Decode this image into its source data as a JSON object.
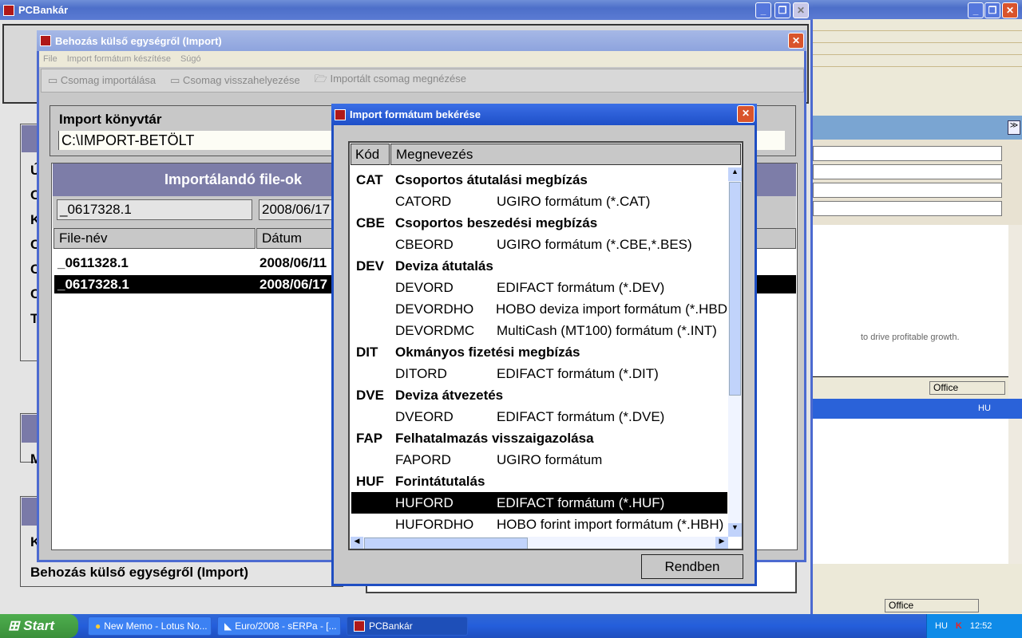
{
  "main_window": {
    "title": "PCBankár"
  },
  "background_panels": {
    "letters": [
      "Ú",
      "C",
      "K",
      "C",
      "C",
      "C",
      "T"
    ],
    "mid_letter": "M",
    "bottom_letter": "K",
    "bottom_label": "Behozás külső egységről (Import)"
  },
  "right_window": {
    "snippet": "to drive profitable growth.",
    "status_office": "Office",
    "lang": "HU",
    "status_office2": "Office"
  },
  "import_window": {
    "title": "Behozás külső egységről (Import)",
    "menu": [
      "File",
      "Import formátum készítése",
      "Súgó"
    ],
    "toolbar": [
      "Csomag importálása",
      "Csomag visszahelyezése",
      "Importált csomag megnézése"
    ],
    "dir_label": "Import könyvtár",
    "dir_value": "C:\\IMPORT-BETÖLT",
    "files_header": "Importálandó file-ok",
    "filter_name": "_0617328.1",
    "filter_date": "2008/06/17 1",
    "columns": [
      "File-név",
      "Dátum"
    ],
    "files": [
      {
        "name": "_0611328.1",
        "date": "2008/06/11"
      },
      {
        "name": "_0617328.1",
        "date": "2008/06/17"
      }
    ]
  },
  "dialog": {
    "title": "Import formátum bekérése",
    "columns": [
      "Kód",
      "Megnevezés"
    ],
    "groups": [
      {
        "code": "CAT",
        "name": "Csoportos átutalási megbízás",
        "items": [
          [
            "CATORD",
            "UGIRO formátum  (*.CAT)"
          ]
        ]
      },
      {
        "code": "CBE",
        "name": "Csoportos beszedési megbízás",
        "items": [
          [
            "CBEORD",
            "UGIRO formátum  (*.CBE,*.BES)"
          ]
        ]
      },
      {
        "code": "DEV",
        "name": "Deviza átutalás",
        "items": [
          [
            "DEVORD",
            "EDIFACT formátum  (*.DEV)"
          ],
          [
            "DEVORDHO",
            "HOBO deviza import formátum  (*.HBD"
          ],
          [
            "DEVORDMC",
            "MultiCash (MT100) formátum  (*.INT)"
          ]
        ]
      },
      {
        "code": "DIT",
        "name": "Okmányos fizetési megbízás",
        "items": [
          [
            "DITORD",
            "EDIFACT formátum  (*.DIT)"
          ]
        ]
      },
      {
        "code": "DVE",
        "name": "Deviza átvezetés",
        "items": [
          [
            "DVEORD",
            "EDIFACT formátum  (*.DVE)"
          ]
        ]
      },
      {
        "code": "FAP",
        "name": "Felhatalmazás visszaigazolása",
        "items": [
          [
            "FAPORD",
            "UGIRO formátum"
          ]
        ]
      },
      {
        "code": "HUF",
        "name": "Forintátutalás",
        "items": [
          [
            "HUFORD",
            "EDIFACT formátum  (*.HUF)"
          ],
          [
            "HUFORDHO",
            "HOBO forint import formátum  (*.HBH)"
          ]
        ]
      }
    ],
    "selected": "HUFORD",
    "ok_label": "Rendben"
  },
  "taskbar": {
    "start": "Start",
    "items": [
      "New Memo - Lotus No...",
      "Euro/2008 - sERPa - [...",
      "PCBankár"
    ],
    "lang": "HU",
    "clock": "12:52"
  }
}
